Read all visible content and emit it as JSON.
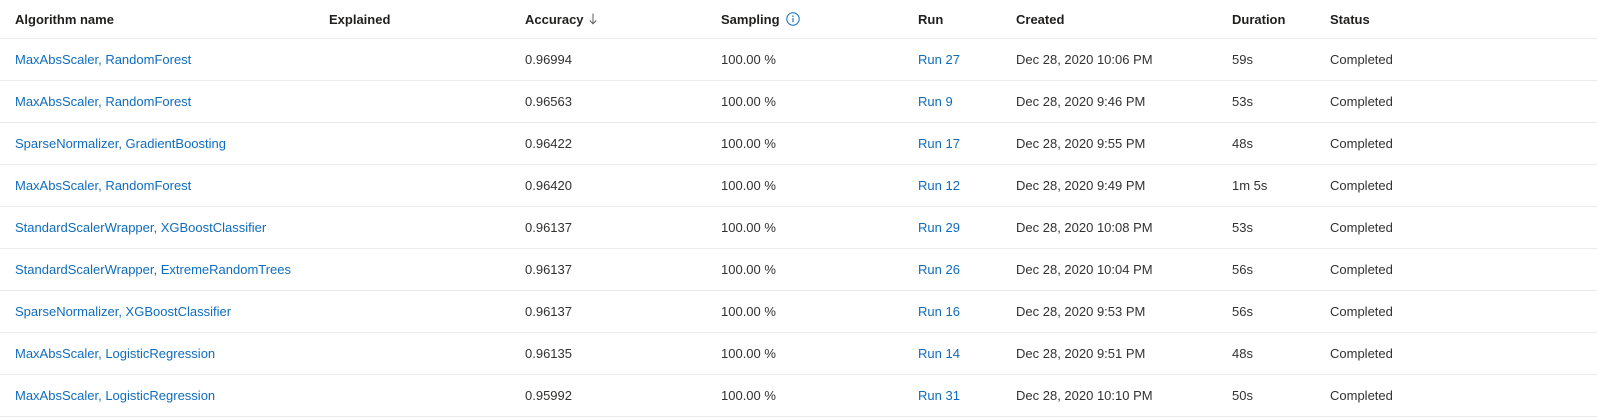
{
  "columns": {
    "algorithm": "Algorithm name",
    "explained": "Explained",
    "accuracy": "Accuracy",
    "sampling": "Sampling",
    "run": "Run",
    "created": "Created",
    "duration": "Duration",
    "status": "Status"
  },
  "icons": {
    "sort": "arrow-down-icon",
    "info": "info-circle-icon"
  },
  "colors": {
    "link": "#0f6cbd",
    "text": "#323130",
    "divider": "#edebe9"
  },
  "rows": [
    {
      "algorithm": "MaxAbsScaler, RandomForest",
      "explained": "",
      "accuracy": "0.96994",
      "sampling": "100.00 %",
      "run": "Run 27",
      "created": "Dec 28, 2020 10:06 PM",
      "duration": "59s",
      "status": "Completed"
    },
    {
      "algorithm": "MaxAbsScaler, RandomForest",
      "explained": "",
      "accuracy": "0.96563",
      "sampling": "100.00 %",
      "run": "Run 9",
      "created": "Dec 28, 2020 9:46 PM",
      "duration": "53s",
      "status": "Completed"
    },
    {
      "algorithm": "SparseNormalizer, GradientBoosting",
      "explained": "",
      "accuracy": "0.96422",
      "sampling": "100.00 %",
      "run": "Run 17",
      "created": "Dec 28, 2020 9:55 PM",
      "duration": "48s",
      "status": "Completed"
    },
    {
      "algorithm": "MaxAbsScaler, RandomForest",
      "explained": "",
      "accuracy": "0.96420",
      "sampling": "100.00 %",
      "run": "Run 12",
      "created": "Dec 28, 2020 9:49 PM",
      "duration": "1m 5s",
      "status": "Completed"
    },
    {
      "algorithm": "StandardScalerWrapper, XGBoostClassifier",
      "explained": "",
      "accuracy": "0.96137",
      "sampling": "100.00 %",
      "run": "Run 29",
      "created": "Dec 28, 2020 10:08 PM",
      "duration": "53s",
      "status": "Completed"
    },
    {
      "algorithm": "StandardScalerWrapper, ExtremeRandomTrees",
      "explained": "",
      "accuracy": "0.96137",
      "sampling": "100.00 %",
      "run": "Run 26",
      "created": "Dec 28, 2020 10:04 PM",
      "duration": "56s",
      "status": "Completed"
    },
    {
      "algorithm": "SparseNormalizer, XGBoostClassifier",
      "explained": "",
      "accuracy": "0.96137",
      "sampling": "100.00 %",
      "run": "Run 16",
      "created": "Dec 28, 2020 9:53 PM",
      "duration": "56s",
      "status": "Completed"
    },
    {
      "algorithm": "MaxAbsScaler, LogisticRegression",
      "explained": "",
      "accuracy": "0.96135",
      "sampling": "100.00 %",
      "run": "Run 14",
      "created": "Dec 28, 2020 9:51 PM",
      "duration": "48s",
      "status": "Completed"
    },
    {
      "algorithm": "MaxAbsScaler, LogisticRegression",
      "explained": "",
      "accuracy": "0.95992",
      "sampling": "100.00 %",
      "run": "Run 31",
      "created": "Dec 28, 2020 10:10 PM",
      "duration": "50s",
      "status": "Completed"
    }
  ]
}
